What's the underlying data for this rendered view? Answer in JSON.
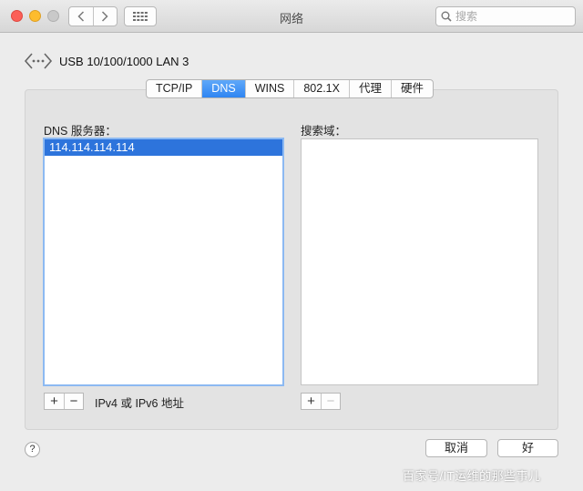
{
  "window": {
    "title": "网络",
    "search_placeholder": "搜索"
  },
  "interface": {
    "name": "USB 10/100/1000 LAN 3",
    "icon": "ethernet-arrows-icon"
  },
  "tabs": [
    {
      "label": "TCP/IP",
      "active": false
    },
    {
      "label": "DNS",
      "active": true
    },
    {
      "label": "WINS",
      "active": false
    },
    {
      "label": "802.1X",
      "active": false
    },
    {
      "label": "代理",
      "active": false
    },
    {
      "label": "硬件",
      "active": false
    }
  ],
  "dns": {
    "header": "DNS 服务器：",
    "servers": [
      "114.114.114.114"
    ],
    "hint": "IPv4 或 IPv6 地址"
  },
  "search_domains": {
    "header": "搜索域：",
    "domains": []
  },
  "buttons": {
    "help": "?",
    "cancel": "取消",
    "ok": "好",
    "add": "+",
    "remove": "−"
  },
  "watermark": "百家号/IT运维的那些事儿",
  "colors": {
    "accent": "#2f85f2",
    "selection": "#2d74dc",
    "close": "#fc5f57",
    "minimize": "#fdbc2e"
  }
}
